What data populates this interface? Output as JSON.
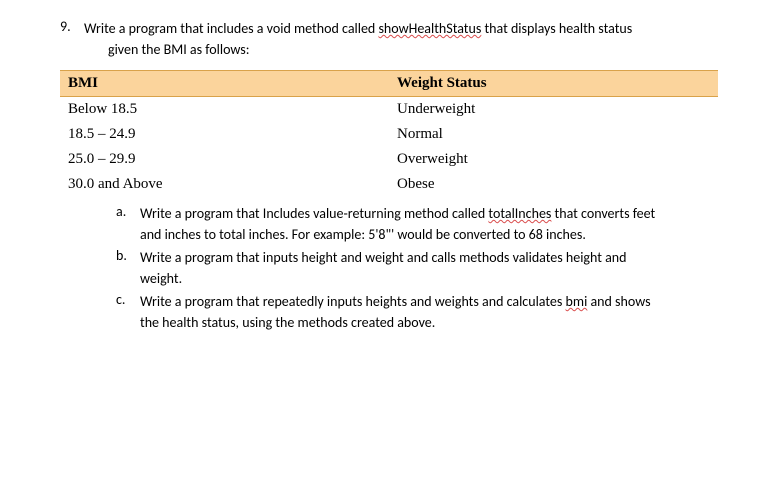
{
  "question": {
    "number": "9.",
    "intro_sp_before": "Write a program that includes a void method called ",
    "intro_spell": "showHealthStatus",
    "intro_sp_after": " that displays health status",
    "intro_line2": "given the BMI as follows:"
  },
  "table": {
    "headers": [
      "BMI",
      "Weight Status"
    ],
    "rows": [
      [
        "Below 18.5",
        "Underweight"
      ],
      [
        "18.5 – 24.9",
        "Normal"
      ],
      [
        "25.0 – 29.9",
        "Overweight"
      ],
      [
        "30.0 and Above",
        "Obese"
      ]
    ]
  },
  "subs": {
    "a": {
      "letter": "a.",
      "p1_before": "Write a program that Includes value-returning method called ",
      "p1_spell": "totalInches",
      "p1_after": " that converts feet",
      "p2": "and inches to total inches. For example: 5'8\"' would be converted to 68 inches."
    },
    "b": {
      "letter": "b.",
      "p1": "Write a program that inputs height and weight and calls methods validates height and",
      "p2": "weight."
    },
    "c": {
      "letter": "c.",
      "p1_before": "Write a program that repeatedly inputs heights and weights and calculates ",
      "p1_spell": "bmi",
      "p1_after": " and shows",
      "p2": "the health status, using the methods created above."
    }
  }
}
